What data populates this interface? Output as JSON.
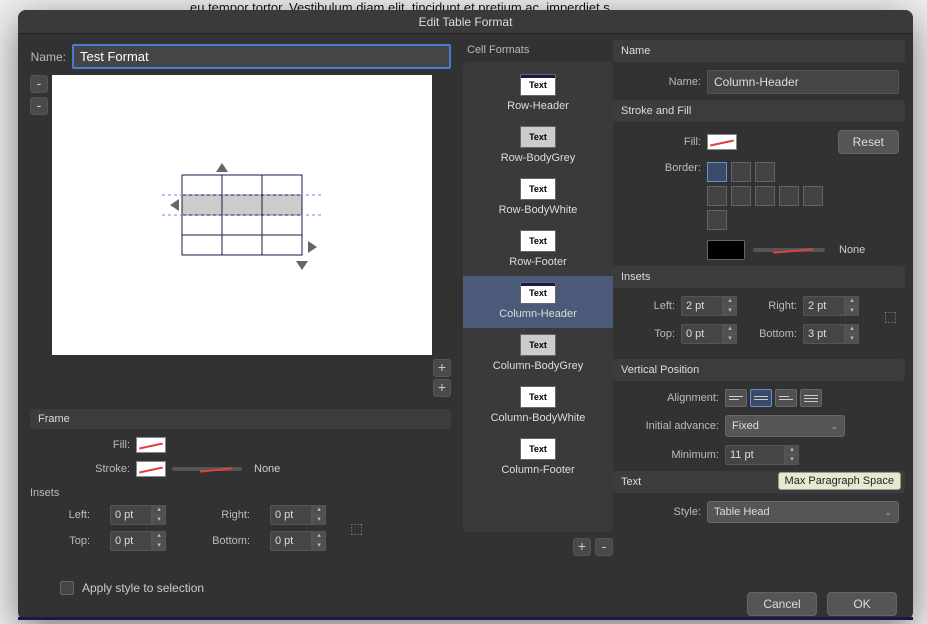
{
  "backdrop_text": "eu tempor tortor. Vestibulum diam elit, tincidunt et pretium ac, imperdiet s",
  "dialog": {
    "title": "Edit Table Format"
  },
  "name_field": {
    "label": "Name:",
    "value": "Test Format"
  },
  "frame": {
    "header": "Frame",
    "fill_label": "Fill:",
    "stroke_label": "Stroke:",
    "stroke_value": "None",
    "insets_header": "Insets",
    "left_label": "Left:",
    "left_value": "0 pt",
    "right_label": "Right:",
    "right_value": "0 pt",
    "top_label": "Top:",
    "top_value": "0 pt",
    "bottom_label": "Bottom:",
    "bottom_value": "0 pt"
  },
  "apply_label": "Apply style to selection",
  "cell_formats": {
    "header": "Cell Formats",
    "items": [
      {
        "label": "Row-Header"
      },
      {
        "label": "Row-BodyGrey"
      },
      {
        "label": "Row-BodyWhite"
      },
      {
        "label": "Row-Footer"
      },
      {
        "label": "Column-Header"
      },
      {
        "label": "Column-BodyGrey"
      },
      {
        "label": "Column-BodyWhite"
      },
      {
        "label": "Column-Footer"
      }
    ],
    "thumb_text": "Text"
  },
  "right": {
    "name_header": "Name",
    "name_label": "Name:",
    "name_value": "Column-Header",
    "stroke_fill_header": "Stroke and Fill",
    "fill_label": "Fill:",
    "reset_label": "Reset",
    "border_label": "Border:",
    "border_value": "None",
    "insets_header": "Insets",
    "left_label": "Left:",
    "left_value": "2 pt",
    "right_label": "Right:",
    "right_value": "2 pt",
    "top_label": "Top:",
    "top_value": "0 pt",
    "bottom_label": "Bottom:",
    "bottom_value": "3 pt",
    "vpos_header": "Vertical Position",
    "align_label": "Alignment:",
    "advance_label": "Initial advance:",
    "advance_value": "Fixed",
    "min_label": "Minimum:",
    "min_value": "11 pt",
    "text_header": "Text",
    "tooltip": "Max Paragraph Space",
    "style_label": "Style:",
    "style_value": "Table Head"
  },
  "footer": {
    "cancel": "Cancel",
    "ok": "OK"
  }
}
